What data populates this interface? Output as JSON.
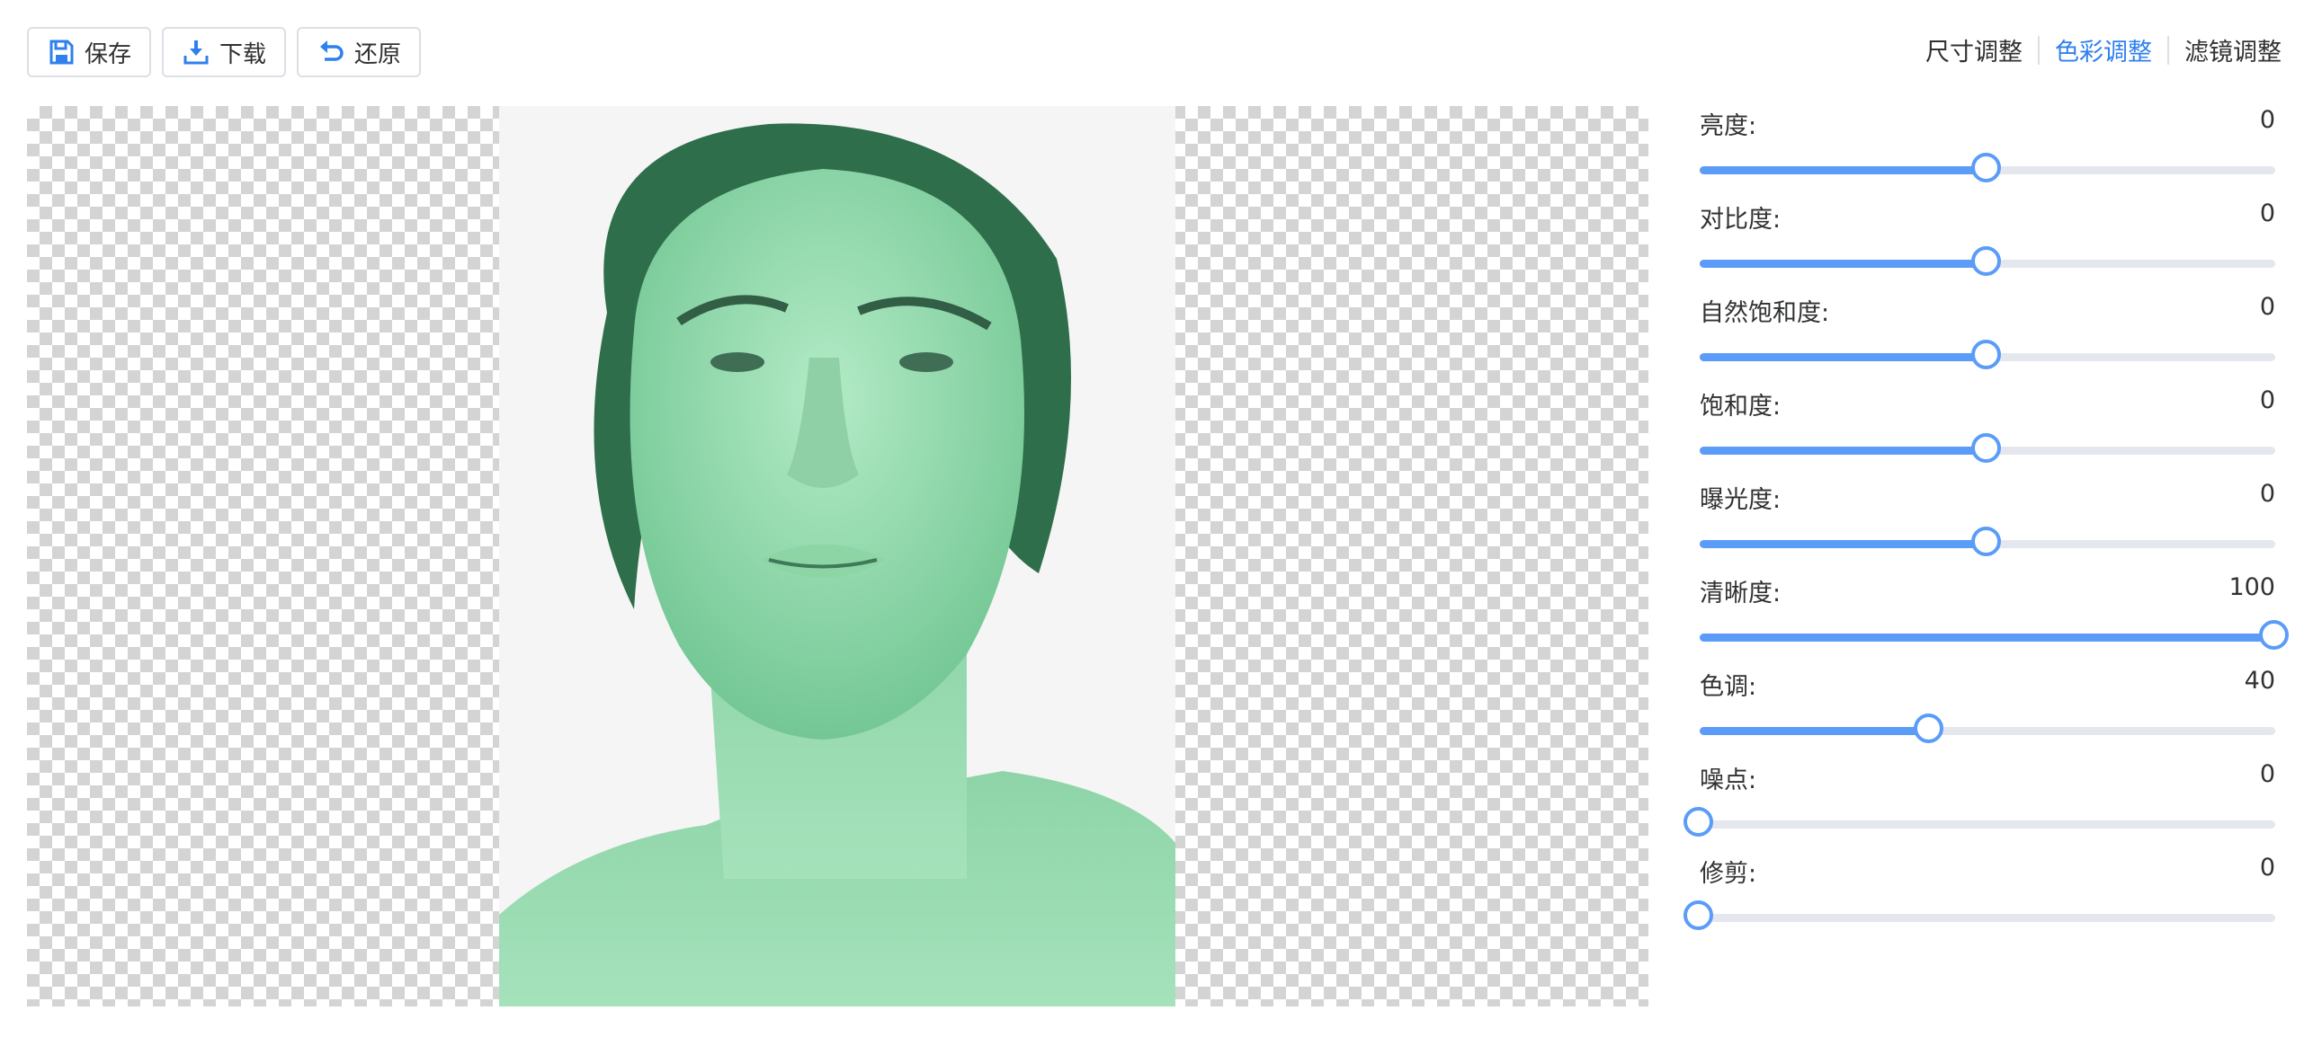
{
  "toolbar": {
    "save": {
      "label": "保存",
      "icon": "save-icon"
    },
    "download": {
      "label": "下载",
      "icon": "download-icon"
    },
    "restore": {
      "label": "还原",
      "icon": "undo-icon"
    }
  },
  "tabs": [
    {
      "label": "尺寸调整",
      "active": false
    },
    {
      "label": "色彩调整",
      "active": true
    },
    {
      "label": "滤镜调整",
      "active": false
    }
  ],
  "colors": {
    "accent": "#2f80ed",
    "slider": "#5a9cf8",
    "track": "#e4e7ed",
    "tint": "#8fd8b0"
  },
  "canvas": {
    "image": "portrait photo with green tint on transparent checkerboard"
  },
  "sliders": [
    {
      "label": "亮度:",
      "value": "0",
      "level": 0.5
    },
    {
      "label": "对比度:",
      "value": "0",
      "level": 0.5
    },
    {
      "label": "自然饱和度:",
      "value": "0",
      "level": 0.5
    },
    {
      "label": "饱和度:",
      "value": "0",
      "level": 0.5
    },
    {
      "label": "曝光度:",
      "value": "0",
      "level": 0.5
    },
    {
      "label": "清晰度:",
      "value": "100",
      "level": 1.0
    },
    {
      "label": "色调:",
      "value": "40",
      "level": 0.4
    },
    {
      "label": "噪点:",
      "value": "0",
      "level": 0.0
    },
    {
      "label": "修剪:",
      "value": "0",
      "level": 0.0
    }
  ]
}
